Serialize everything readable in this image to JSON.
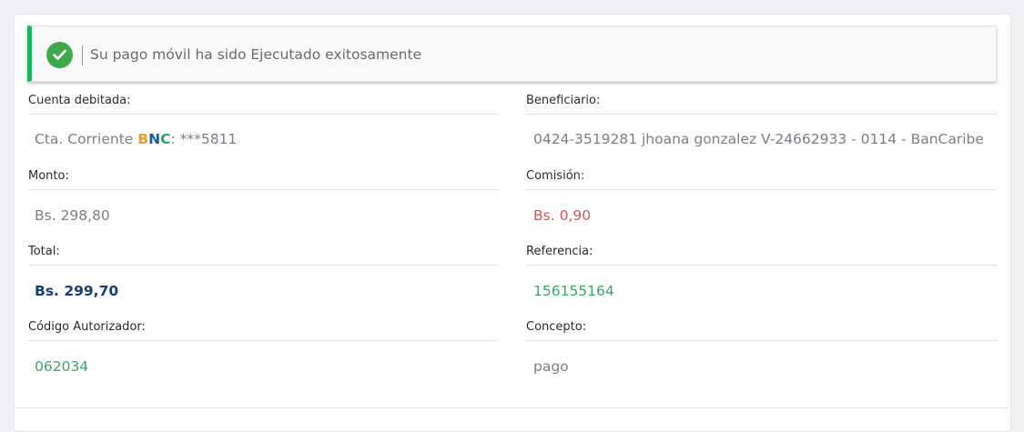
{
  "alert": {
    "message": "Su pago móvil ha sido Ejecutado exitosamente"
  },
  "fields": {
    "cuenta": {
      "label": "Cuenta debitada:",
      "prefix": "Cta. Corriente ",
      "bank_b": "B",
      "bank_n": "N",
      "bank_c": "C",
      "suffix": ": ***5811"
    },
    "beneficiario": {
      "label": "Beneficiario:",
      "value": "0424-3519281 jhoana gonzalez V-24662933 - 0114 - BanCaribe"
    },
    "monto": {
      "label": "Monto:",
      "value": "Bs. 298,80"
    },
    "comision": {
      "label": "Comisión:",
      "value": "Bs. 0,90"
    },
    "total": {
      "label": "Total:",
      "value": "Bs. 299,70"
    },
    "referencia": {
      "label": "Referencia:",
      "value": "156155164"
    },
    "codigo": {
      "label": "Código Autorizador:",
      "value": "062034"
    },
    "concepto": {
      "label": "Concepto:",
      "value": "pago"
    }
  },
  "colors": {
    "success_accent": "#1bb55c",
    "check_icon": "#3ea84c",
    "commission_red": "#d9534f",
    "highlight_green": "#3aa866",
    "total_navy": "#163e7a",
    "bnc_orange": "#f0a020",
    "bnc_blue": "#1a5c9b",
    "bnc_green": "#2aa56a"
  },
  "icons": {
    "alert_icon": "check-circle-icon"
  }
}
